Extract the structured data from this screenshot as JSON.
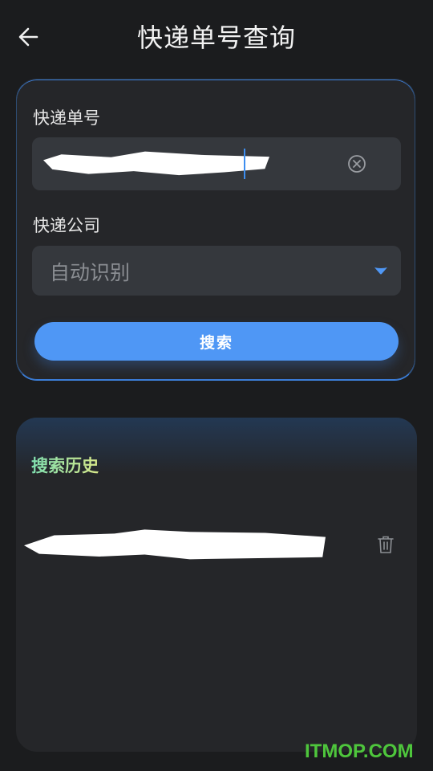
{
  "header": {
    "title": "快递单号查询",
    "back_icon": "arrow-left-icon"
  },
  "query": {
    "number_label": "快递单号",
    "number_value": "",
    "clear_icon": "circle-x-icon",
    "company_label": "快递公司",
    "company_value": "自动识别",
    "dropdown_icon": "triangle-down-icon",
    "search_label": "搜索"
  },
  "history": {
    "title": "搜索历史",
    "items": [
      {
        "text": "",
        "delete_icon": "trash-icon"
      }
    ]
  },
  "watermark": "ITMOP.COM",
  "colors": {
    "accent": "#4f97f5",
    "card_bg": "#252629",
    "page_bg": "#1b1c1e",
    "input_bg": "#35383d"
  }
}
